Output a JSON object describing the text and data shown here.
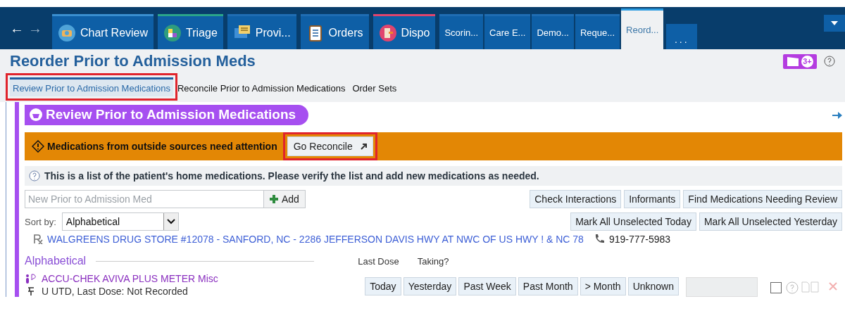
{
  "nav": {
    "back": "←",
    "forward": "→"
  },
  "tabs": [
    {
      "label": "Chart Review",
      "kind": "icon",
      "color": "#3a8fd0",
      "selected": false
    },
    {
      "label": "Triage",
      "kind": "icon",
      "color": "#2aa58a",
      "selected": false
    },
    {
      "label": "Provi...",
      "kind": "icon",
      "color": "#1f6db3",
      "selected": false
    },
    {
      "label": "Orders",
      "kind": "icon",
      "color": "#1f6db3",
      "selected": false
    },
    {
      "label": "Dispo",
      "kind": "icon",
      "color": "#e0456e",
      "selected": false
    },
    {
      "label": "Scorin...",
      "kind": "plain",
      "color": "#1f6db3",
      "selected": false
    },
    {
      "label": "Care E...",
      "kind": "plain",
      "color": "#1f6db3",
      "selected": false
    },
    {
      "label": "Demo...",
      "kind": "plain",
      "color": "#1f6db3",
      "selected": false
    },
    {
      "label": "Reque...",
      "kind": "plain",
      "color": "#1f6db3",
      "selected": false
    },
    {
      "label": "Reord...",
      "kind": "plain",
      "color": "#2a9be0",
      "selected": true
    }
  ],
  "overflow_tab": "...",
  "page_title": "Reorder Prior to Admission Meds",
  "notification_badge": "3+",
  "subtabs": [
    {
      "label": "Review Prior to Admission Medications",
      "selected": true,
      "highlighted": true
    },
    {
      "label": "Reconcile Prior to Admission Medications",
      "selected": false,
      "highlighted": false
    },
    {
      "label": "Order Sets",
      "selected": false,
      "highlighted": false
    }
  ],
  "section_title": "Review Prior to Admission Medications",
  "alert": {
    "text": "Medications from outside sources need attention",
    "button": "Go Reconcile",
    "button_highlighted": true
  },
  "info": "This is a list of the patient's home medications. Please verify the list and add new medications as needed.",
  "new_med": {
    "placeholder": "New Prior to Admission Med",
    "add_button": "Add"
  },
  "toolbar_buttons": [
    "Check Interactions",
    "Informants",
    "Find Medications Needing Review"
  ],
  "sort": {
    "label": "Sort by:",
    "value": "Alphabetical"
  },
  "mark_buttons": [
    "Mark All Unselected Today",
    "Mark All Unselected Yesterday"
  ],
  "pharmacy": {
    "name": "WALGREENS DRUG STORE #12078 - SANFORD, NC - 2286 JEFFERSON DAVIS HWY AT NWC OF US HWY ! & NC 78",
    "phone": "919-777-5983"
  },
  "group_heading": "Alphabetical",
  "columns": [
    "Last Dose",
    "Taking?"
  ],
  "medications": [
    {
      "name": "ACCU-CHEK AVIVA PLUS METER Misc",
      "detail": "U UTD, Last Dose: Not Recorded",
      "dose_buttons": [
        "Today",
        "Yesterday",
        "Past Week",
        "Past Month",
        "> Month",
        "Unknown"
      ],
      "taking": false
    }
  ]
}
